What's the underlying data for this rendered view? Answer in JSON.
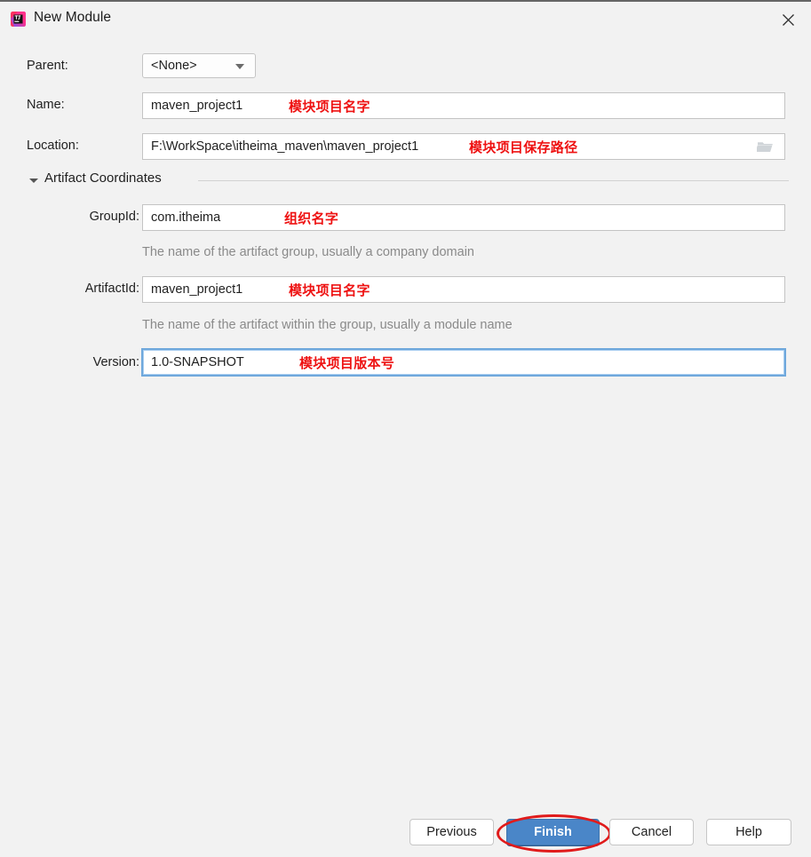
{
  "window": {
    "title": "New Module",
    "app_icon": "intellij-idea-icon",
    "close_icon": "close-icon"
  },
  "form": {
    "parent": {
      "label": "Parent:",
      "value": "<None>",
      "dropdown_icon": "chevron-down-icon"
    },
    "name": {
      "label": "Name:",
      "value": "maven_project1",
      "annotation": "模块项目名字"
    },
    "location": {
      "label": "Location:",
      "value": "F:\\WorkSpace\\itheima_maven\\maven_project1",
      "annotation": "模块项目保存路径",
      "browse_icon": "folder-icon"
    }
  },
  "artifact_coordinates": {
    "section_title": "Artifact Coordinates",
    "collapse_icon": "triangle-down-icon",
    "group_id": {
      "label": "GroupId:",
      "value": "com.itheima",
      "annotation": "组织名字",
      "help": "The name of the artifact group, usually a company domain"
    },
    "artifact_id": {
      "label": "ArtifactId:",
      "value": "maven_project1",
      "annotation": "模块项目名字",
      "help": "The name of the artifact within the group, usually a module name"
    },
    "version": {
      "label": "Version:",
      "value": "1.0-SNAPSHOT",
      "annotation": "模块项目版本号",
      "focused": true
    }
  },
  "buttons": {
    "previous": "Previous",
    "finish": "Finish",
    "cancel": "Cancel",
    "help": "Help"
  },
  "colors": {
    "dialog_background": "#f2f2f2",
    "annotation_red": "#ee1111",
    "primary_button": "#4a86c8",
    "focus_border": "#6fa8dc",
    "help_text": "#8a8a8a",
    "highlight_ellipse": "#e01b1b"
  }
}
